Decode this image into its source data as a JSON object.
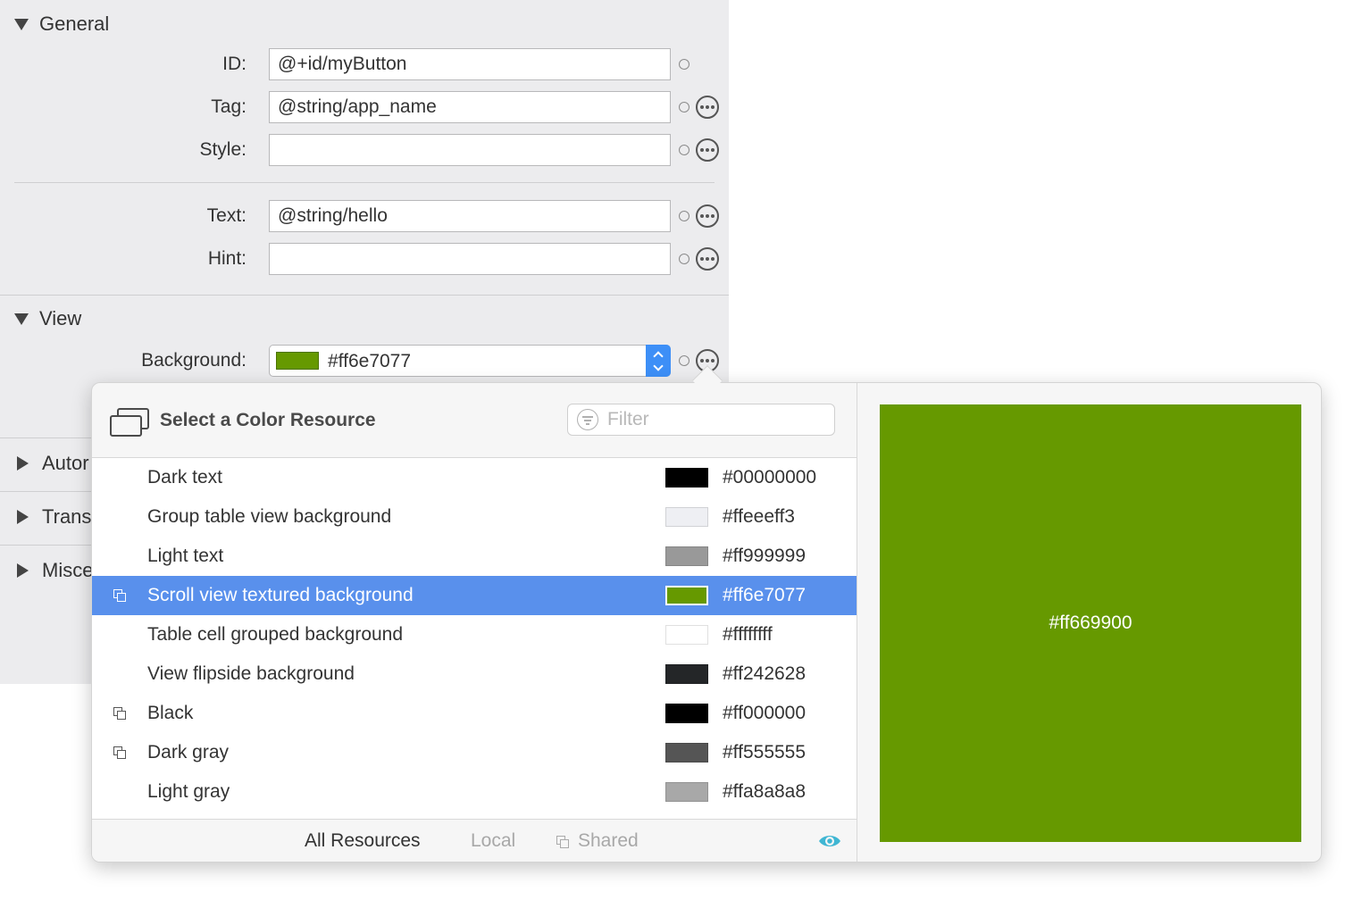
{
  "general": {
    "title": "General",
    "fields": [
      {
        "label": "ID:",
        "value": "@+id/myButton",
        "has_more": false
      },
      {
        "label": "Tag:",
        "value": "@string/app_name",
        "has_more": true
      },
      {
        "label": "Style:",
        "value": "",
        "has_more": true
      },
      {
        "label": "Text:",
        "value": "@string/hello",
        "has_more": true
      },
      {
        "label": "Hint:",
        "value": "",
        "has_more": true
      }
    ]
  },
  "view": {
    "title": "View",
    "background_label": "Background:",
    "background_value": "#ff6e7077",
    "background_swatch_color": "#669900"
  },
  "collapsed_sections": [
    "Autor",
    "Trans",
    "Misce"
  ],
  "popover": {
    "title": "Select a Color Resource",
    "filter_placeholder": "Filter",
    "resources": [
      {
        "name": "Dark text",
        "hex": "#00000000",
        "swatch": "#000000",
        "shared": false,
        "selected": false
      },
      {
        "name": "Group table view background",
        "hex": "#ffeeeff3",
        "swatch": "#eeeff3",
        "shared": false,
        "selected": false
      },
      {
        "name": "Light text",
        "hex": "#ff999999",
        "swatch": "#999999",
        "shared": false,
        "selected": false
      },
      {
        "name": "Scroll view textured background",
        "hex": "#ff6e7077",
        "swatch": "#669900",
        "shared": true,
        "selected": true
      },
      {
        "name": "Table cell grouped background",
        "hex": "#ffffffff",
        "swatch": "#ffffff",
        "shared": false,
        "selected": false
      },
      {
        "name": "View flipside background",
        "hex": "#ff242628",
        "swatch": "#242628",
        "shared": false,
        "selected": false
      },
      {
        "name": "Black",
        "hex": "#ff000000",
        "swatch": "#000000",
        "shared": true,
        "selected": false
      },
      {
        "name": "Dark gray",
        "hex": "#ff555555",
        "swatch": "#555555",
        "shared": true,
        "selected": false
      },
      {
        "name": "Light gray",
        "hex": "#ffa8a8a8",
        "swatch": "#a8a8a8",
        "shared": false,
        "selected": false
      }
    ],
    "footer": {
      "all_resources": "All Resources",
      "local": "Local",
      "shared": "Shared"
    },
    "preview": {
      "color": "#669900",
      "label": "#ff669900"
    },
    "accent_color": "#5990ec",
    "eye_color": "#3fb6d3"
  }
}
